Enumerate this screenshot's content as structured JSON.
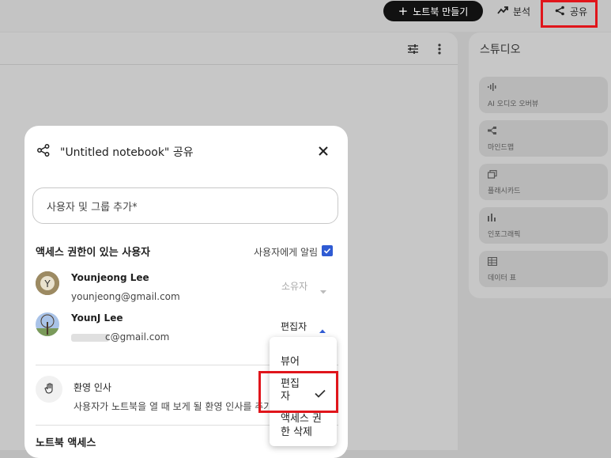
{
  "header": {
    "new_notebook_label": "노트북 만들기",
    "analytics_label": "분석",
    "share_label": "공유"
  },
  "studio": {
    "title": "스튜디오",
    "cards": [
      {
        "label": "AI 오디오 오버뷰",
        "icon": "audio-waveform-icon"
      },
      {
        "label": "마인드맵",
        "icon": "mind-map-icon"
      },
      {
        "label": "플래시카드",
        "icon": "flashcards-icon"
      },
      {
        "label": "인포그래픽",
        "icon": "infographic-icon"
      },
      {
        "label": "데이터 표",
        "icon": "data-table-icon"
      }
    ]
  },
  "dialog": {
    "title": "\"Untitled notebook\" 공유",
    "add_placeholder": "사용자 및 그룹 추가*",
    "access_section": "액세스 권한이 있는 사용자",
    "notify_label": "사용자에게 알림",
    "users": [
      {
        "name": "Younjeong Lee",
        "email": "younjeong@gmail.com",
        "role": "소유자"
      },
      {
        "name": "YounJ Lee",
        "email_blurred": "c@gmail.com",
        "role": "편집자"
      }
    ],
    "welcome_title": "환영 인사",
    "welcome_desc": "사용자가 노트북을 열 때 보게 될 환영 인사를 추가",
    "notebook_access": "노트북 액세스"
  },
  "role_dropdown": {
    "options": [
      "뷰어",
      "편집\n자",
      "액세스 권\n한 삭제"
    ],
    "selected": "편집\n자"
  },
  "colors": {
    "accent_blue": "#2f5bd3",
    "highlight_red": "#e0151b"
  }
}
